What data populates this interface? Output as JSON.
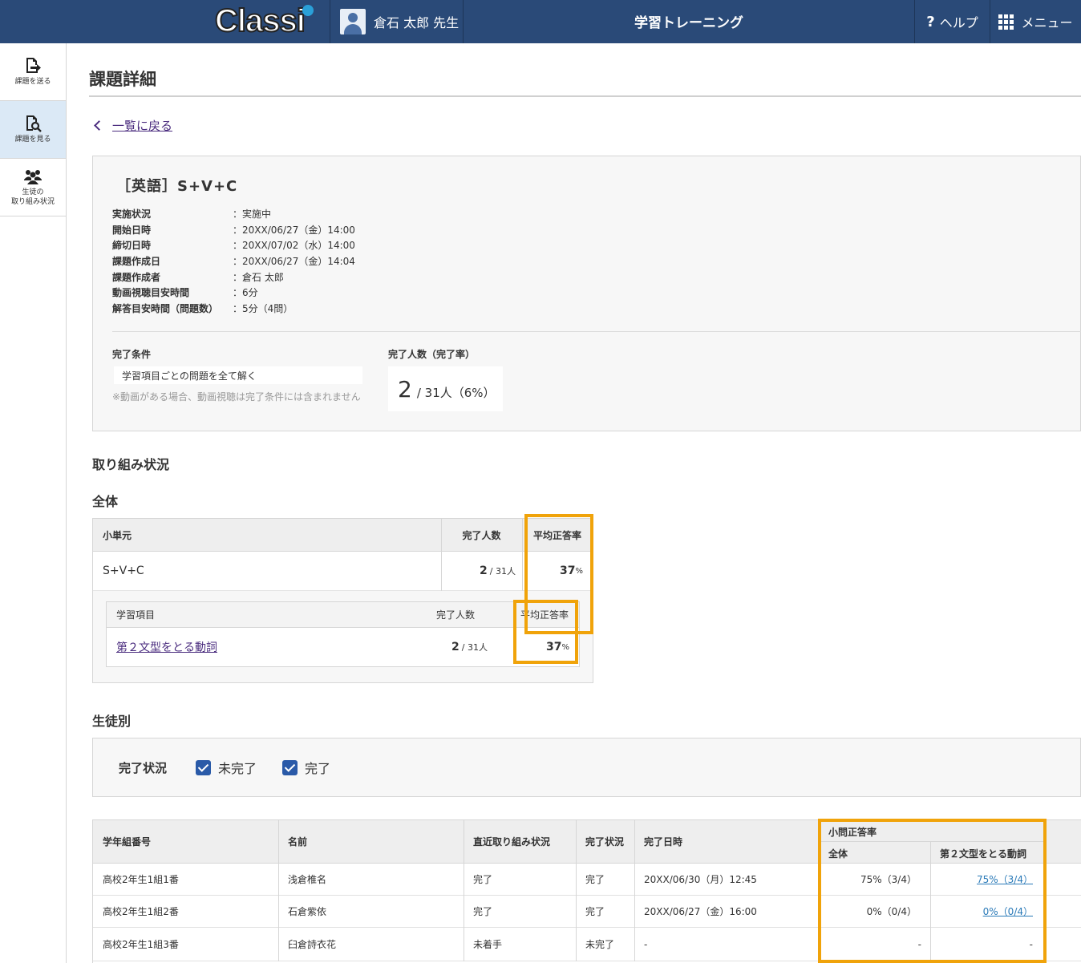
{
  "header": {
    "logo_text": "Classi",
    "user_name": "倉石 太郎 先生",
    "app_title": "学習トレーニング",
    "help_label": "ヘルプ",
    "menu_label": "メニュー",
    "help_icon": "?"
  },
  "sidebar": {
    "items": [
      {
        "label": "課題を送る",
        "icon": "send-assignment-icon",
        "active": false
      },
      {
        "label": "課題を見る",
        "icon": "view-assignment-icon",
        "active": true
      },
      {
        "label_line1": "生徒の",
        "label_line2": "取り組み状況",
        "icon": "students-icon",
        "active": false
      }
    ]
  },
  "page": {
    "title": "課題詳細",
    "back_link": "一覧に戻る"
  },
  "assignment": {
    "title": "［英語］S+V+C",
    "info": [
      {
        "key": "実施状況",
        "value": "実施中"
      },
      {
        "key": "開始日時",
        "value": "20XX/06/27（金）14:00"
      },
      {
        "key": "締切日時",
        "value": "20XX/07/02（水）14:00"
      },
      {
        "key": "課題作成日",
        "value": "20XX/06/27（金）14:04"
      },
      {
        "key": "課題作成者",
        "value": "倉石 太郎"
      },
      {
        "key": "動画視聴目安時間",
        "value": "6分"
      },
      {
        "key": "解答目安時間（問題数）",
        "value": "5分（4問）"
      }
    ],
    "colon": "：",
    "completion_condition_label": "完了条件",
    "completion_condition_value": "学習項目ごとの問題を全て解く",
    "completion_note": "※動画がある場合、動画視聴は完了条件には含まれません",
    "completed_label": "完了人数（完了率）",
    "completed_count": "2",
    "completed_total": "/ 31人（6%）"
  },
  "progress": {
    "section_title": "取り組み状況",
    "overall_title": "全体",
    "overall_table": {
      "headers": [
        "小単元",
        "完了人数",
        "平均正答率"
      ],
      "row": {
        "unit": "S+V+C",
        "count": "2",
        "count_total": "/ 31人",
        "rate": "37",
        "rate_unit": "%"
      }
    },
    "item_table": {
      "headers": [
        "学習項目",
        "完了人数",
        "平均正答率"
      ],
      "row": {
        "item": "第２文型をとる動詞",
        "count": "2",
        "count_total": "/ 31人",
        "rate": "37",
        "rate_unit": "%"
      }
    }
  },
  "students": {
    "section_title": "生徒別",
    "filter_label": "完了状況",
    "filters": [
      {
        "label": "未完了",
        "checked": true
      },
      {
        "label": "完了",
        "checked": true
      }
    ],
    "headers": {
      "class_no": "学年組番号",
      "name": "名前",
      "recent": "直近取り組み状況",
      "status": "完了状況",
      "date": "完了日時",
      "rate_group": "小問正答率",
      "rate_all": "全体",
      "rate_item": "第２文型をとる動詞"
    },
    "rows": [
      {
        "class_no": "高校2年生1組1番",
        "name": "浅倉椎名",
        "recent": "完了",
        "status": "完了",
        "date": "20XX/06/30（月）12:45",
        "rate_all": "75%（3/4）",
        "rate_item": "75%（3/4）"
      },
      {
        "class_no": "高校2年生1組2番",
        "name": "石倉紫依",
        "recent": "完了",
        "status": "完了",
        "date": "20XX/06/27（金）16:00",
        "rate_all": "0%（0/4）",
        "rate_item": "0%（0/4）"
      },
      {
        "class_no": "高校2年生1組3番",
        "name": "臼倉詩衣花",
        "recent": "未着手",
        "status": "未完了",
        "date": "-",
        "rate_all": "-",
        "rate_item": "-"
      }
    ]
  },
  "colors": {
    "header_bg": "#2a4a78",
    "highlight": "#f0a30a",
    "link_purple": "#4b2d7f",
    "link_blue": "#2a7ab8",
    "checkbox": "#2a5aa8",
    "sidebar_active": "#dbe9f6"
  }
}
